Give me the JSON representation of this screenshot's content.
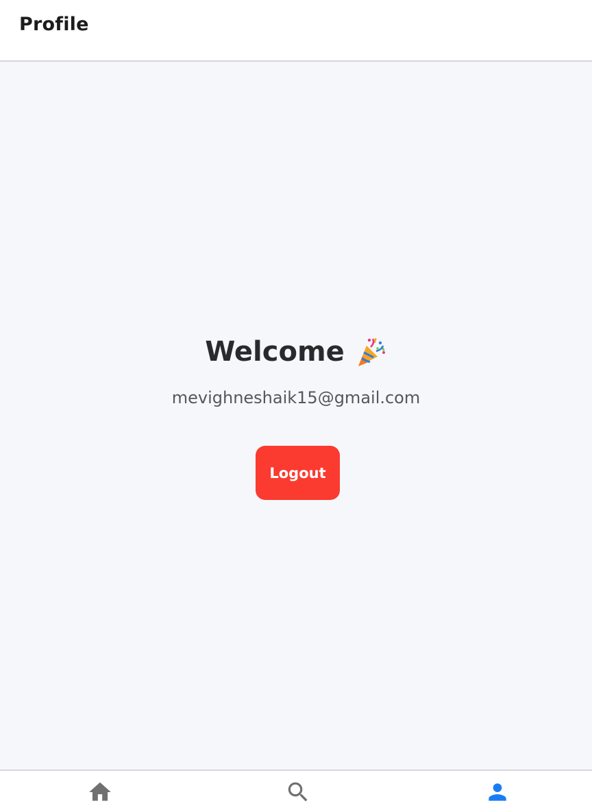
{
  "header": {
    "title": "Profile"
  },
  "profile": {
    "welcome": "Welcome",
    "welcome_icon": "party-popper-icon",
    "email": "mevighneshaik15@gmail.com",
    "logout_label": "Logout"
  },
  "tabbar": {
    "tabs": [
      {
        "name": "home",
        "icon": "home-icon",
        "active": false
      },
      {
        "name": "search",
        "icon": "search-icon",
        "active": false
      },
      {
        "name": "profile",
        "icon": "person-icon",
        "active": true
      }
    ]
  },
  "colors": {
    "accent": "#1a7cf5",
    "logout": "#fb3a30",
    "inactive_icon": "#707070",
    "background": "#f6f7fa"
  }
}
